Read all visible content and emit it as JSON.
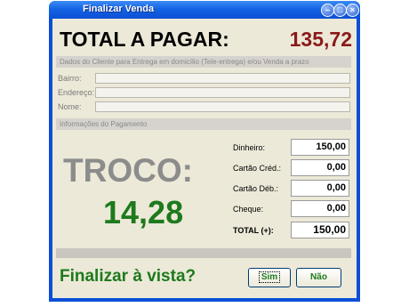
{
  "window": {
    "title": "Finalizar Venda",
    "controls": {
      "minimize": "–",
      "maximize": "□",
      "close": "×"
    }
  },
  "total": {
    "label": "TOTAL A PAGAR:",
    "value": "135,72"
  },
  "client_section": {
    "heading": "Dados do Cliente para Entrega em domicílio (Tele-entrega) e/ou Venda a prazo",
    "fields": [
      {
        "label": "Bairro:",
        "value": ""
      },
      {
        "label": "Endereço:",
        "value": ""
      },
      {
        "label": "Nome:",
        "value": ""
      }
    ]
  },
  "payment_section": {
    "heading": "Informações do Pagamento",
    "rows": [
      {
        "label": "Dinheiro:",
        "value": "150,00"
      },
      {
        "label": "Cartão Créd.:",
        "value": "0,00"
      },
      {
        "label": "Cartão Déb.:",
        "value": "0,00"
      },
      {
        "label": "Cheque:",
        "value": "0,00"
      },
      {
        "label": "TOTAL (+):",
        "value": "150,00"
      }
    ]
  },
  "change": {
    "label": "TROCO:",
    "value": "14,28"
  },
  "finalize": {
    "question": "Finalizar à vista?",
    "yes_label": "Sim",
    "no_label": "Não"
  }
}
